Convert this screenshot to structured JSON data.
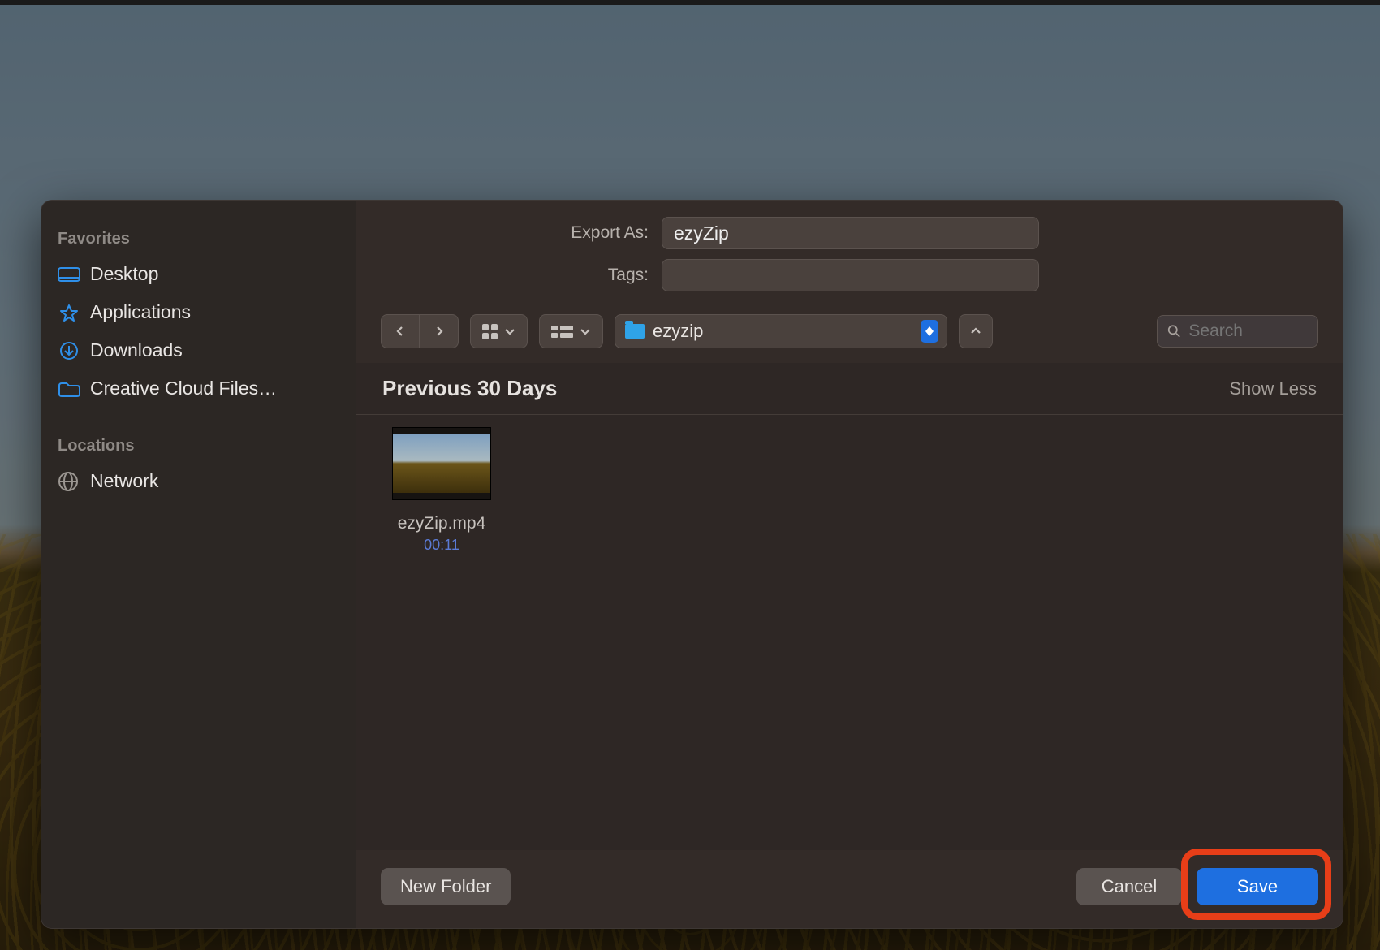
{
  "form": {
    "export_label": "Export As:",
    "export_value": "ezyZip",
    "tags_label": "Tags:",
    "tags_value": ""
  },
  "toolbar": {
    "current_folder": "ezyzip",
    "search_placeholder": "Search"
  },
  "sidebar": {
    "sections": {
      "favorites_label": "Favorites",
      "locations_label": "Locations"
    },
    "favorites": [
      {
        "label": "Desktop"
      },
      {
        "label": "Applications"
      },
      {
        "label": "Downloads"
      },
      {
        "label": "Creative Cloud Files…"
      }
    ],
    "locations": [
      {
        "label": "Network"
      }
    ]
  },
  "list": {
    "section_title": "Previous 30 Days",
    "show_less": "Show Less",
    "files": [
      {
        "name": "ezyZip.mp4",
        "duration": "00:11"
      }
    ]
  },
  "buttons": {
    "new_folder": "New Folder",
    "cancel": "Cancel",
    "save": "Save"
  }
}
